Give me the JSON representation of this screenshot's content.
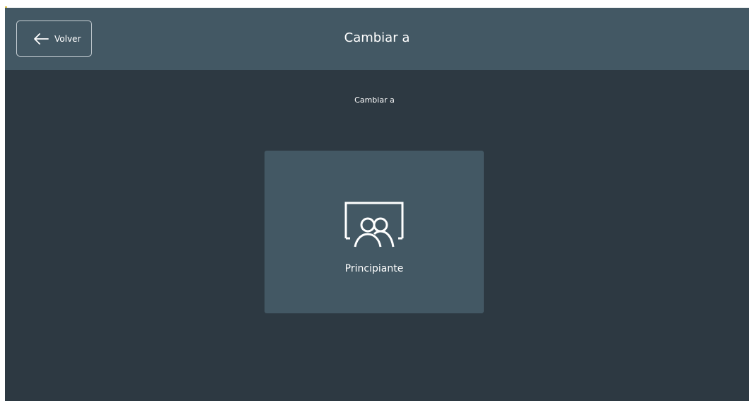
{
  "header": {
    "back_label": "Volver",
    "title": "Cambiar a"
  },
  "main": {
    "subtitle": "Cambiar a",
    "options": [
      {
        "label": "Principiante",
        "icon": "classroom-users-icon"
      }
    ]
  },
  "colors": {
    "header_bg": "#435864",
    "app_bg": "#2d3942",
    "card_bg": "#435864",
    "text": "#ffffff"
  }
}
